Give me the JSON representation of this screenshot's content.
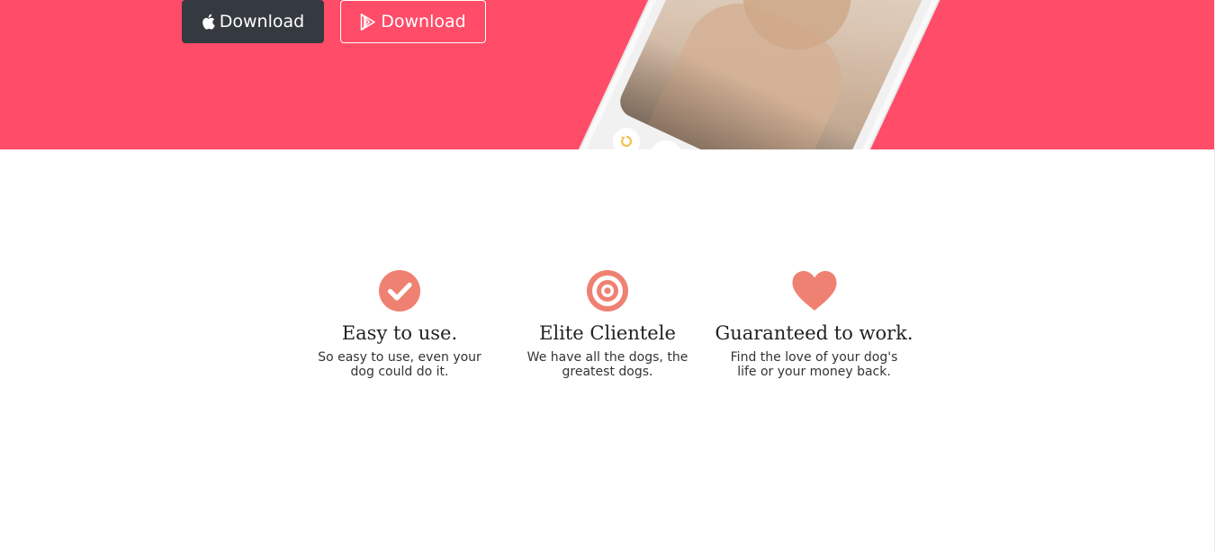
{
  "hero": {
    "background": "#ff4c68",
    "buttons": [
      {
        "label": "Download",
        "icon": "apple-icon"
      },
      {
        "label": "Download",
        "icon": "google-play-icon"
      }
    ]
  },
  "features": {
    "accent": "#ef8172",
    "items": [
      {
        "icon": "check-circle-icon",
        "title": "Easy to use.",
        "text": "So easy to use, even your dog could do it."
      },
      {
        "icon": "bullseye-icon",
        "title": "Elite Clientele",
        "text": "We have all the dogs, the greatest dogs."
      },
      {
        "icon": "heart-icon",
        "title": "Guaranteed to work.",
        "text": "Find the love of your dog's life or your money back."
      }
    ]
  }
}
